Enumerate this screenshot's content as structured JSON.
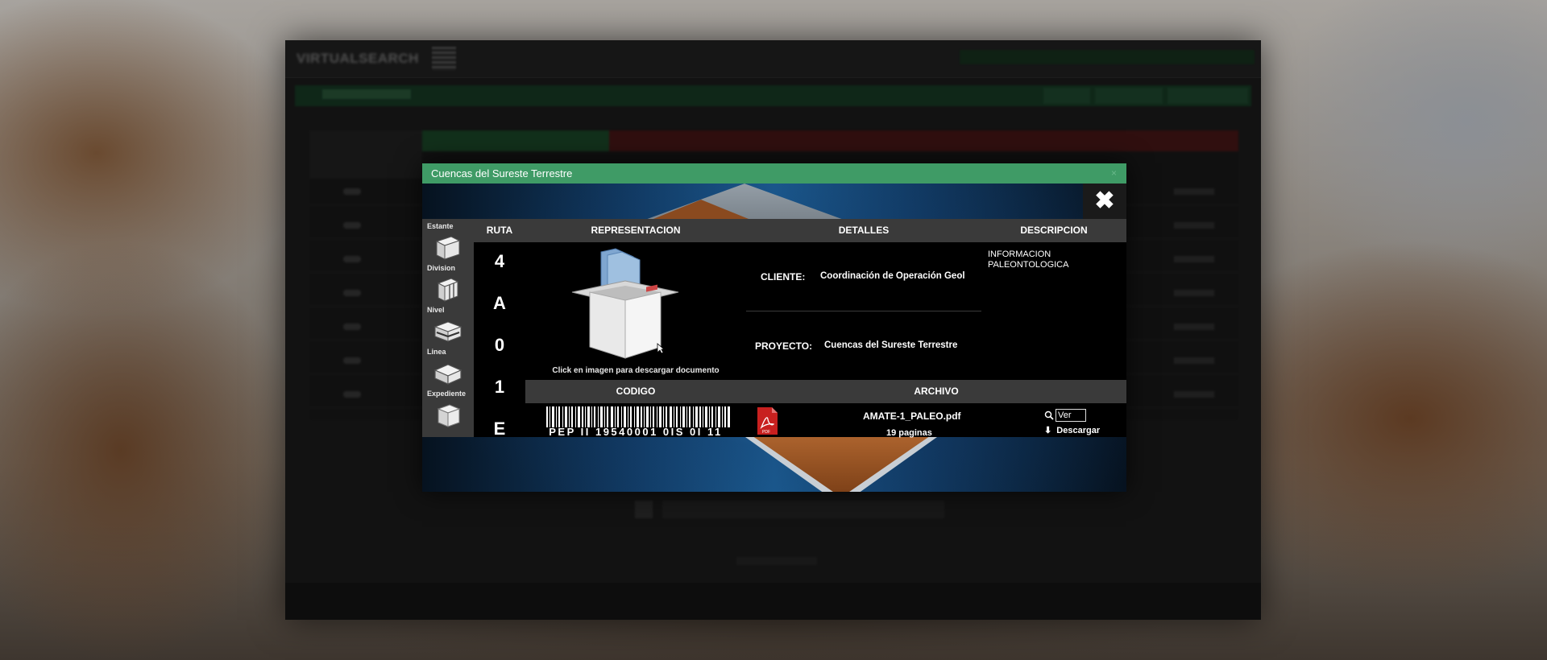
{
  "background_app": {
    "logo_text": "VIRTUALSEARCH"
  },
  "modal": {
    "title": "Cuencas del Sureste Terrestre",
    "close_label": "✖",
    "titlebar_close": "×"
  },
  "left_icons": [
    {
      "label": "Estante",
      "icon": "shelf-icon"
    },
    {
      "label": "Division",
      "icon": "division-icon"
    },
    {
      "label": "Nivel",
      "icon": "level-icon"
    },
    {
      "label": "Linea",
      "icon": "line-icon"
    },
    {
      "label": "Expediente",
      "icon": "file-box-icon"
    }
  ],
  "headers": {
    "ruta": "RUTA",
    "representacion": "REPRESENTACION",
    "detalles": "DETALLES",
    "descripcion": "DESCRIPCION",
    "codigo": "CODIGO",
    "archivo": "ARCHIVO"
  },
  "ruta": [
    "4",
    "A",
    "0",
    "1",
    "E"
  ],
  "representacion": {
    "caption": "Click en imagen para descargar documento"
  },
  "detalles": {
    "cliente_label": "CLIENTE:",
    "cliente_value": "Coordinación de Operación Geol",
    "proyecto_label": "PROYECTO:",
    "proyecto_value": "Cuencas del Sureste Terrestre"
  },
  "descripcion": {
    "text": "INFORMACION PALEONTOLOGICA"
  },
  "codigo": {
    "barcode_text": "PEP II 19540001 0IS 0I 11"
  },
  "archivo": {
    "file_name": "AMATE-1_PALEO.pdf",
    "pages": "19 paginas",
    "ver_label": "Ver",
    "descargar_label": "Descargar"
  },
  "colors": {
    "titlebar": "#3f9b66",
    "panel_header": "#3a3a3a",
    "panel_bg": "#000000"
  }
}
